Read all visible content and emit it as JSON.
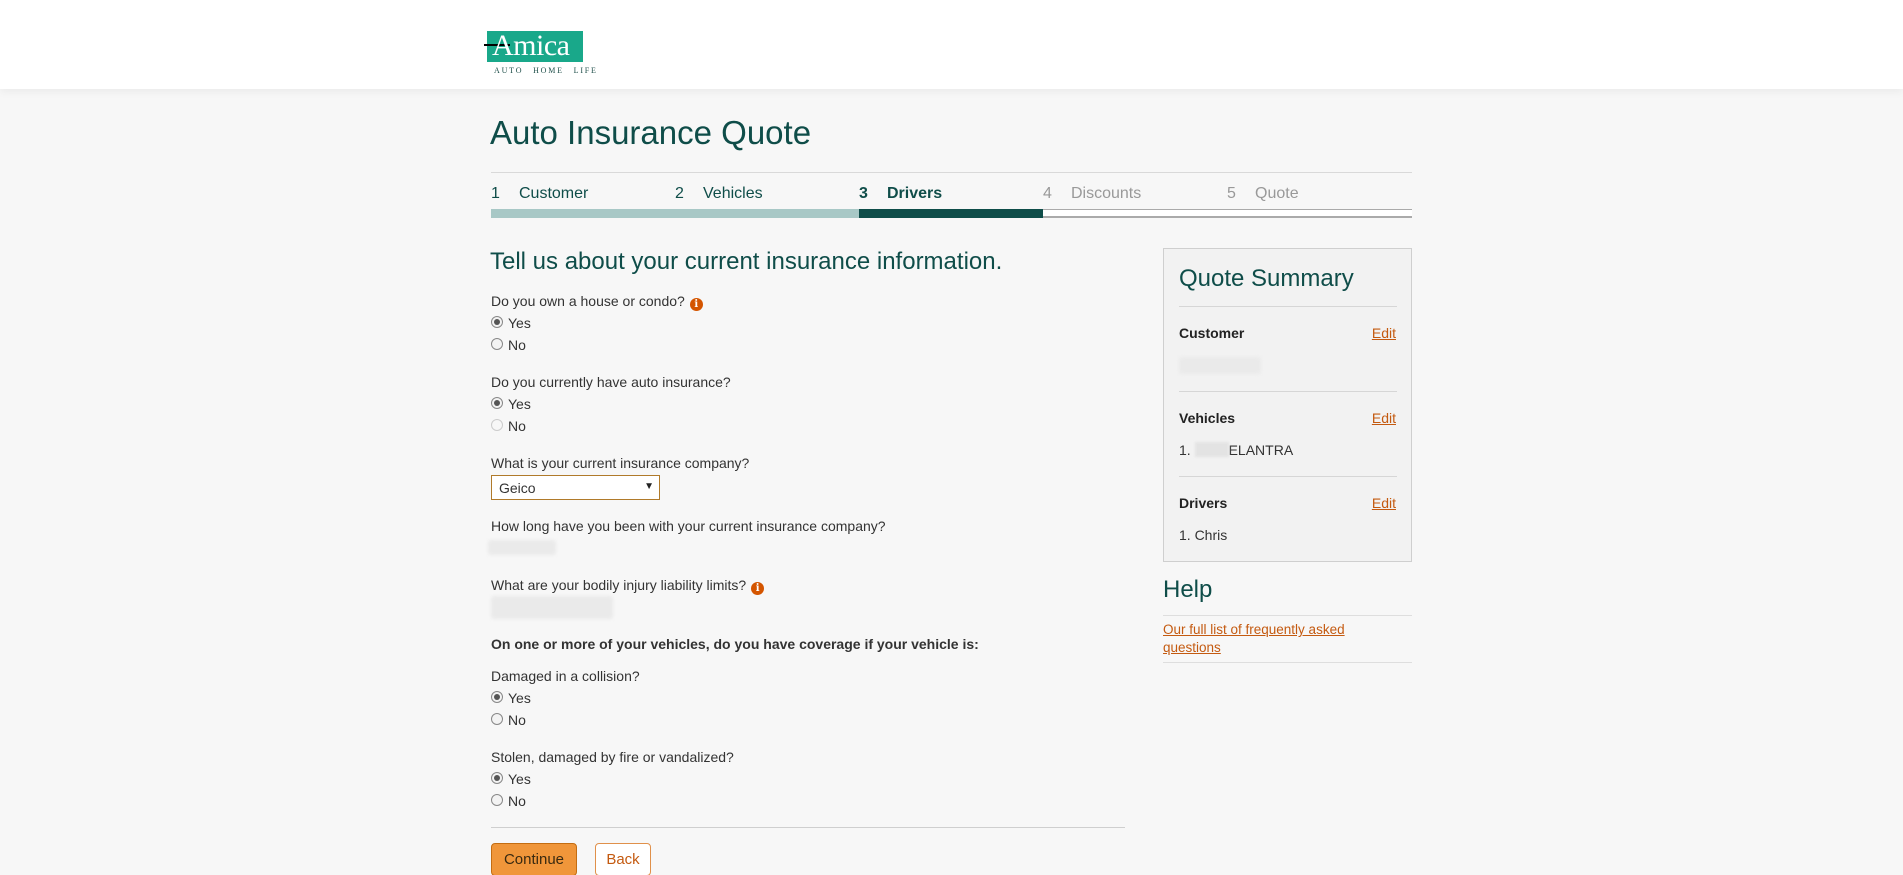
{
  "brand": {
    "logo_text": "Amica",
    "tagline": "AUTO HOME LIFE",
    "colors": {
      "brand_green": "#19a88a",
      "dark_teal": "#0f4d49",
      "accent_orange": "#d45500",
      "button_orange": "#f0963a"
    }
  },
  "page": {
    "title": "Auto Insurance Quote"
  },
  "steps": [
    {
      "num": "1",
      "label": "Customer",
      "state": "done"
    },
    {
      "num": "2",
      "label": "Vehicles",
      "state": "done"
    },
    {
      "num": "3",
      "label": "Drivers",
      "state": "current"
    },
    {
      "num": "4",
      "label": "Discounts",
      "state": "future"
    },
    {
      "num": "5",
      "label": "Quote",
      "state": "future"
    }
  ],
  "form": {
    "heading": "Tell us about your current insurance information.",
    "q_house": "Do you own a house or condo?",
    "q_auto": "Do you currently have auto insurance?",
    "q_company": "What is your current insurance company?",
    "company_value": "Geico",
    "q_how_long": "How long have you been with your current insurance company?",
    "q_bodily": "What are your bodily injury liability limits?",
    "coverage_heading": "On one or more of your vehicles, do you have coverage if your vehicle is:",
    "q_collision": "Damaged in a collision?",
    "q_stolen": "Stolen, damaged by fire or vandalized?",
    "yes_label": "Yes",
    "no_label": "No",
    "continue_label": "Continue",
    "back_label": "Back"
  },
  "summary": {
    "title": "Quote Summary",
    "edit_label": "Edit",
    "customer_label": "Customer",
    "vehicles_label": "Vehicles",
    "vehicle_1": "1.",
    "vehicle_1_model": "ELANTRA",
    "drivers_label": "Drivers",
    "driver_1": "1. Chris"
  },
  "help": {
    "title": "Help",
    "faq_link": "Our full list of frequently asked questions"
  }
}
